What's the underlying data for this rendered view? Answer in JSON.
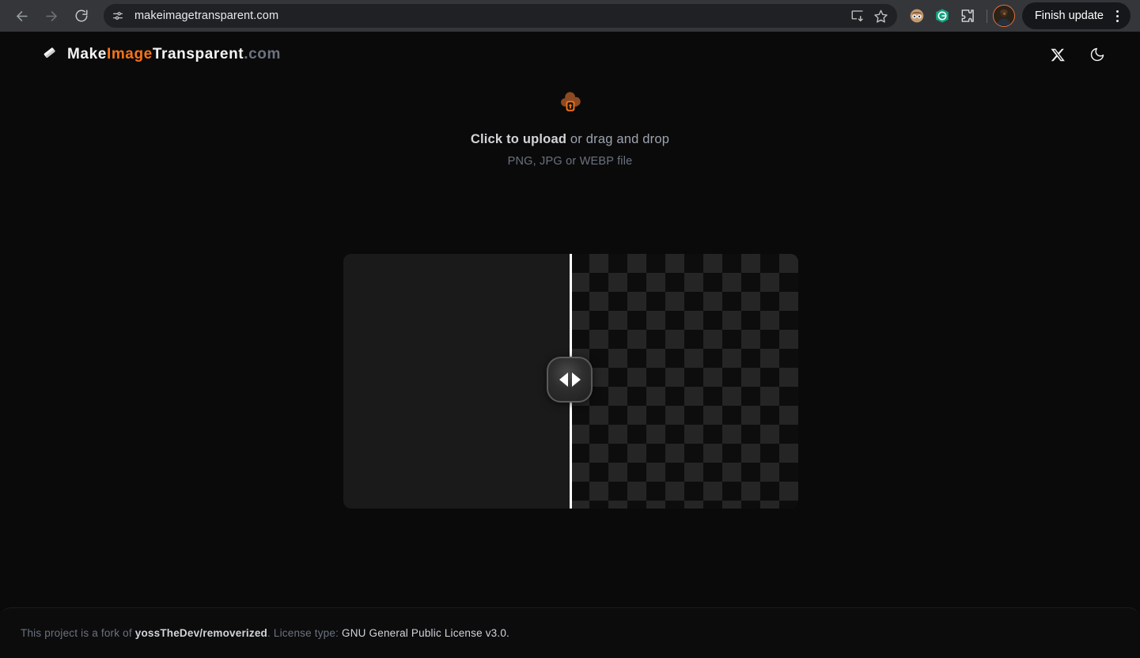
{
  "browser": {
    "back_label": "Back",
    "forward_label": "Forward",
    "reload_label": "Reload",
    "site_info_icon": "tune-icon",
    "url": "makeimagetransparent.com",
    "install_icon": "install-app-icon",
    "bookmark_icon": "star-icon",
    "extensions": [
      {
        "name": "extension-icon-face",
        "label": ""
      },
      {
        "name": "extension-icon-grammarly",
        "label": "G"
      },
      {
        "name": "extensions-puzzle-icon",
        "label": ""
      }
    ],
    "profile_label": "Profile",
    "update_button": "Finish update",
    "menu_icon": "kebab-menu-icon"
  },
  "site": {
    "brand": {
      "icon": "eraser-icon",
      "part1": "Make",
      "part2": "Image",
      "part3": "Transparent",
      "part4": ".com"
    },
    "header_actions": [
      {
        "name": "twitter-x-link",
        "label": "X"
      },
      {
        "name": "theme-toggle-button",
        "label": "Dark mode"
      }
    ]
  },
  "upload": {
    "icon": "cloud-upload-icon",
    "main_bold": "Click to upload",
    "main_rest": " or drag and drop",
    "sub": "PNG, JPG or WEBP file"
  },
  "compare": {
    "handle_icon": "slider-handle-icon",
    "left_arrow": "left-arrow",
    "right_arrow": "right-arrow",
    "position_percent": 50
  },
  "footer": {
    "prefix": "This project is a fork of ",
    "repo": "yossTheDev/removerized",
    "middle": ". License type: ",
    "license": "GNU General Public License v3.0."
  },
  "colors": {
    "accent": "#f97316",
    "page_bg": "#0a0a0a",
    "chrome_bg": "#35363a",
    "omnibox_bg": "#202124",
    "panel_bg": "#1a1a1a"
  }
}
